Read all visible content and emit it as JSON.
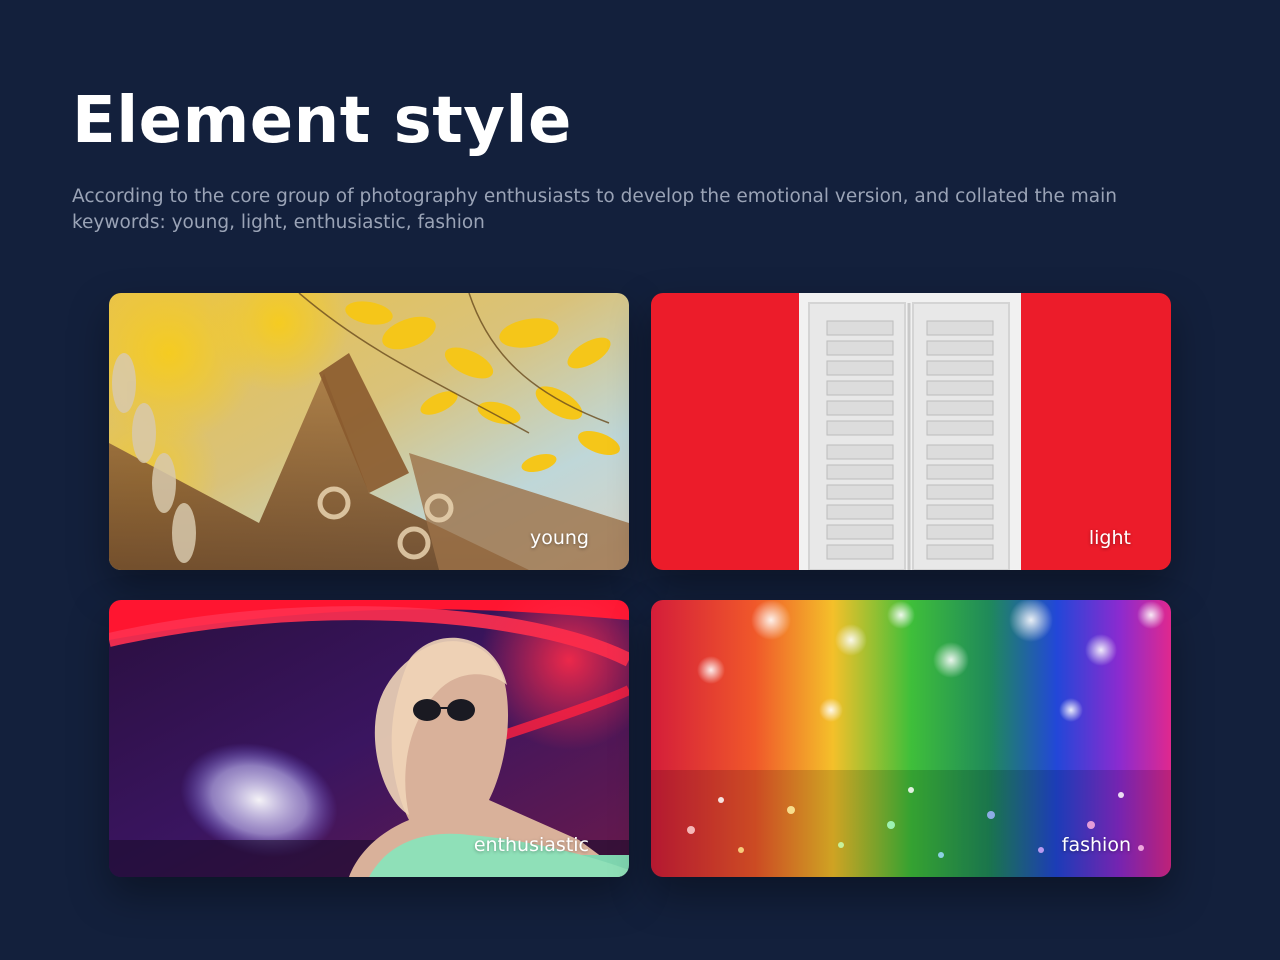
{
  "header": {
    "title": "Element style",
    "description": "According to the core group of photography enthusiasts to develop the emotional version, and collated the main keywords: young, light, enthusiastic, fashion"
  },
  "cards": [
    {
      "label": "young",
      "image": "ginkgo-leaves-and-temple-roof"
    },
    {
      "label": "light",
      "image": "white-shutters-on-red-wall"
    },
    {
      "label": "enthusiastic",
      "image": "woman-in-sunglasses-neon-light"
    },
    {
      "label": "fashion",
      "image": "rainbow-glitter-bokeh"
    }
  ],
  "colors": {
    "background": "#13203c",
    "title": "#ffffff",
    "description": "#9aa3b6",
    "label": "#ffffff"
  }
}
